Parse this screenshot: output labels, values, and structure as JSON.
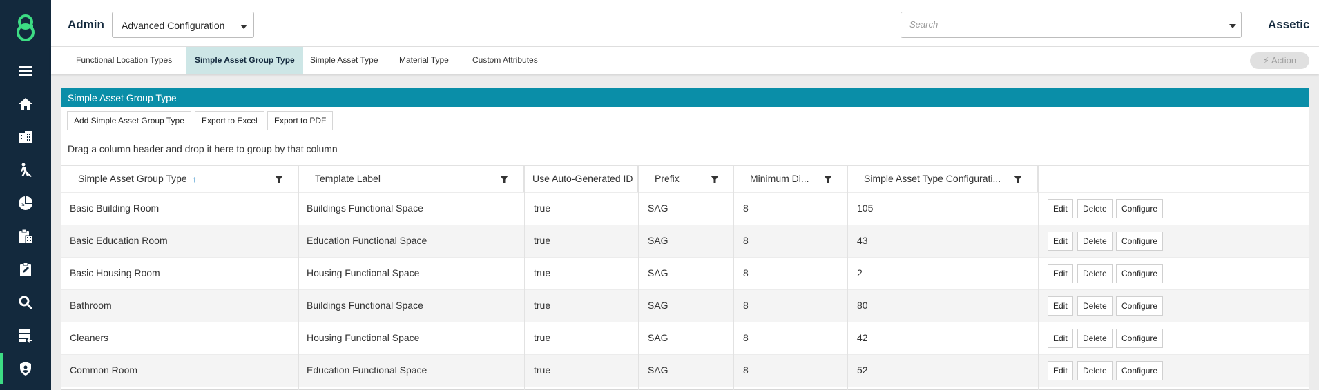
{
  "header": {
    "section": "Admin",
    "config_select": "Advanced Configuration",
    "search_placeholder": "Search",
    "brand": "Assetic"
  },
  "sidebar": {
    "items": [
      {
        "icon": "menu-icon"
      },
      {
        "icon": "home-icon"
      },
      {
        "icon": "buildings-icon"
      },
      {
        "icon": "worker-icon"
      },
      {
        "icon": "finance-chart-icon"
      },
      {
        "icon": "clipboard-calculator-icon"
      },
      {
        "icon": "clipboard-edit-icon"
      },
      {
        "icon": "search-icon"
      },
      {
        "icon": "data-import-icon"
      },
      {
        "icon": "shield-user-icon",
        "active": true
      }
    ],
    "accent": "#3ddc84",
    "background": "#13293d"
  },
  "tabs": [
    {
      "label": "Functional Location Types",
      "active": false
    },
    {
      "label": "Simple Asset Group Type",
      "active": true
    },
    {
      "label": "Simple Asset Type",
      "active": false
    },
    {
      "label": "Material Type",
      "active": false
    },
    {
      "label": "Custom Attributes",
      "active": false
    }
  ],
  "action_button": "Action",
  "panel": {
    "title": "Simple Asset Group Type",
    "title_color": "#0a8ea8",
    "toolbar": [
      "Add Simple Asset Group Type",
      "Export to Excel",
      "Export to PDF"
    ],
    "group_hint": "Drag a column header and drop it here to group by that column"
  },
  "table": {
    "columns": [
      {
        "label": "Simple Asset Group Type",
        "sorted": "ascending",
        "filter": true
      },
      {
        "label": "Template Label",
        "filter": true
      },
      {
        "label": "Use Auto-Generated ID",
        "filter": false
      },
      {
        "label": "Prefix",
        "filter": true
      },
      {
        "label": "Minimum Di...",
        "filter": true
      },
      {
        "label": "Simple Asset Type Configurati...",
        "filter": true
      },
      {
        "label": "",
        "filter": false
      }
    ],
    "row_actions": [
      "Edit",
      "Delete",
      "Configure"
    ],
    "rows": [
      {
        "name": "Basic Building Room",
        "template": "Buildings Functional Space",
        "auto_id": "true",
        "prefix": "SAG",
        "min_digits": "8",
        "config": "105"
      },
      {
        "name": "Basic Education Room",
        "template": "Education Functional Space",
        "auto_id": "true",
        "prefix": "SAG",
        "min_digits": "8",
        "config": "43"
      },
      {
        "name": "Basic Housing Room",
        "template": "Housing Functional Space",
        "auto_id": "true",
        "prefix": "SAG",
        "min_digits": "8",
        "config": "2"
      },
      {
        "name": "Bathroom",
        "template": "Buildings Functional Space",
        "auto_id": "true",
        "prefix": "SAG",
        "min_digits": "8",
        "config": "80"
      },
      {
        "name": "Cleaners",
        "template": "Housing Functional Space",
        "auto_id": "true",
        "prefix": "SAG",
        "min_digits": "8",
        "config": "42"
      },
      {
        "name": "Common Room",
        "template": "Education Functional Space",
        "auto_id": "true",
        "prefix": "SAG",
        "min_digits": "8",
        "config": "52"
      }
    ]
  }
}
